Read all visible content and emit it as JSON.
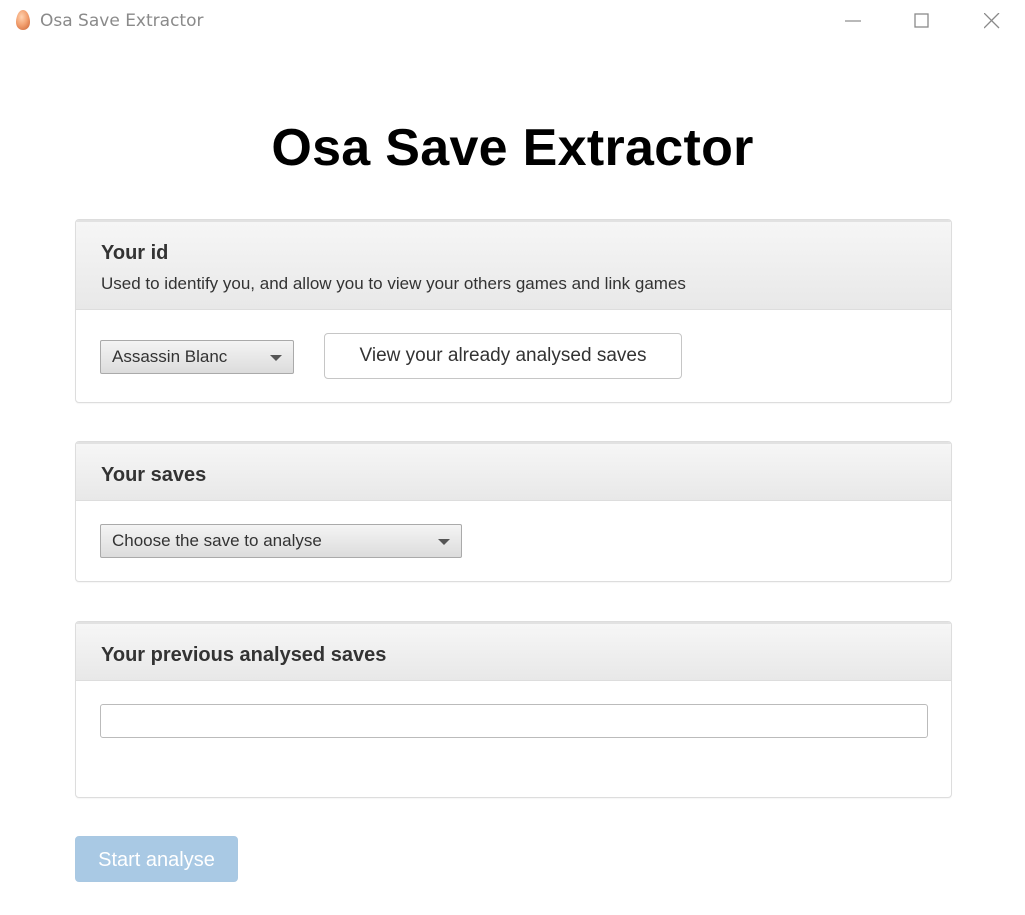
{
  "window": {
    "title": "Osa Save Extractor",
    "controls": {
      "minimize": "minimize-icon",
      "maximize": "maximize-icon",
      "close": "close-icon"
    }
  },
  "page": {
    "title": "Osa Save Extractor"
  },
  "panels": {
    "id": {
      "title": "Your id",
      "subtitle": "Used to identify you, and allow you to view your others games and link games",
      "select_value": "Assassin Blanc",
      "view_button_label": "View your already analysed saves"
    },
    "saves": {
      "title": "Your saves",
      "select_value": "Choose the save to analyse"
    },
    "previous": {
      "title": "Your previous analysed saves",
      "input_value": ""
    }
  },
  "actions": {
    "start_label": "Start analyse",
    "start_disabled": true
  },
  "colors": {
    "start_button": "#a9c9e4",
    "panel_border": "#dddddd",
    "app_icon": "#f0a070"
  }
}
